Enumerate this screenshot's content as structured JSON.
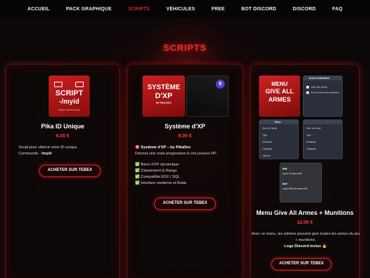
{
  "nav": {
    "items": [
      "ACCUEIL",
      "PACK GRAPHIQUE",
      "SCRIPTS",
      "VÉHICULES",
      "FREE",
      "BOT DISCORD",
      "DISCORD",
      "FAQ"
    ],
    "active": "SCRIPTS"
  },
  "section_title": "SCRIPTS",
  "colors": {
    "accent": "#e0262b",
    "background": "#0b0707",
    "price": "#ff3b3b"
  },
  "products": [
    {
      "thumbnail": {
        "line1": "SCRIPT",
        "line2": "-/myid",
        "caption": "Obtenir votre ID unique"
      },
      "title": "Pika ID Unique",
      "price": "6.00 €",
      "desc": "Script pour obtenir votre ID unique.",
      "command_label": "Commande :",
      "command": "/myid",
      "button": "ACHETER SUR TEBEX"
    },
    {
      "thumbnail": {
        "line1": "SYSTÈME",
        "line2": "D'XP",
        "caption": "BY PIKA DEV",
        "badge": "8"
      },
      "title": "Système d'XP",
      "price": "6.00 €",
      "subtitle": "🎯 Système d'XP – by PikaDev",
      "desc": "Donnez une vraie progression à vos joueurs RP.",
      "features": [
        "✅ Barre d'XP dynamique",
        "✅ Classement & Rangs",
        "✅ Compatible ESX / SQL",
        "✅ Interface moderne et fluide"
      ],
      "button": "ACHETER SUR TEBEX"
    },
    {
      "thumbnail": {
        "line1": "MENU",
        "line2": "GIVE ALL",
        "line3": "ARMES"
      },
      "title": "Menu Give All Armes + Munitions",
      "price": "12.00 €",
      "desc": "Avec ce menu, les admins peuvent give toutes les armes du jeu + munitions.",
      "extra": "Logs Discord inclus 🔥",
      "button": "ACHETER SUR TEBEX",
      "preview": {
        "menu_title": "Armes & Munitions",
        "menu_items": [
          "Liste des armes",
          "Donner toutes les munitions"
        ],
        "panel_title": "Menu",
        "rows": [
          "Nom de l'arme",
          "Type",
          "Munitions",
          "Catégorie",
          "Options"
        ],
        "discord_lines": [
          "Staff",
          "a give 10 ammo rifle",
          "Staff",
          "a give 9000 de ammo rifle"
        ]
      }
    }
  ]
}
